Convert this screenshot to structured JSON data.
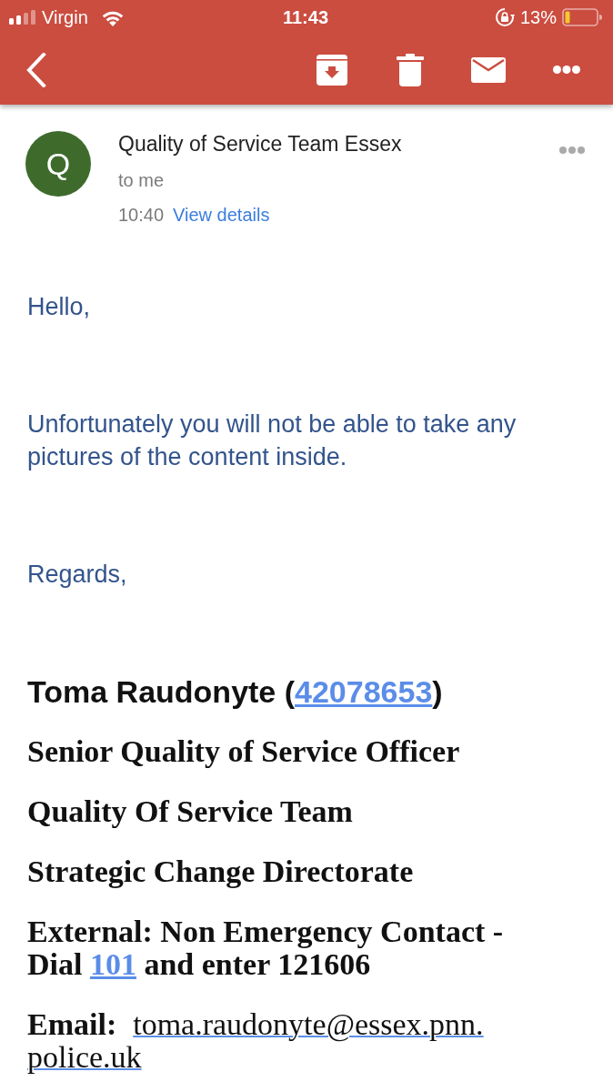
{
  "status_bar": {
    "carrier": "Virgin",
    "time": "11:43",
    "battery": "13%"
  },
  "message": {
    "sender": {
      "initial": "Q",
      "name": "Quality of Service Team Essex"
    },
    "recipient": "to me",
    "time": "10:40",
    "details_link": "View details"
  },
  "body": {
    "paragraphs": [
      "Hello,",
      "Unfortunately you will not be able to take any pictures of the content inside.",
      "Regards,"
    ]
  },
  "signature": {
    "name_line": {
      "text": "Toma Raudonyte (",
      "link": "42078653",
      "after": ")"
    },
    "lines": [
      "Senior Quality of Service Officer",
      "Quality Of Service Team",
      "Strategic Change Directorate"
    ],
    "contact": {
      "text": "External: Non Emergency Contact - Dial ",
      "link": "101",
      "after": " and enter 121606"
    },
    "email": {
      "label": "Email:",
      "address_lines": [
        "toma.raudonyte@essex.pnn.",
        "police.uk"
      ]
    }
  }
}
